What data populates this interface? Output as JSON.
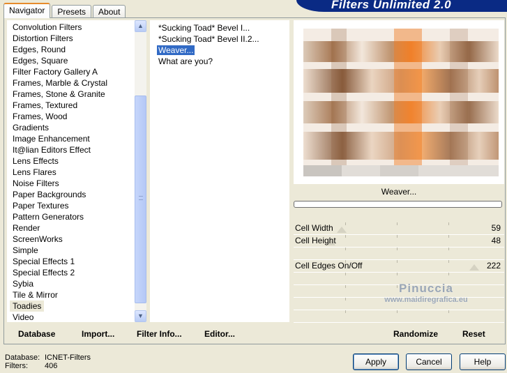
{
  "tabs": [
    "Navigator",
    "Presets",
    "About"
  ],
  "banner_title": "Filters Unlimited 2.0",
  "categories": [
    "Convolution Filters",
    "Distortion Filters",
    "Edges, Round",
    "Edges, Square",
    "Filter Factory Gallery A",
    "Frames, Marble & Crystal",
    "Frames, Stone & Granite",
    "Frames, Textured",
    "Frames, Wood",
    "Gradients",
    "Image Enhancement",
    "It@lian Editors Effect",
    "Lens Effects",
    "Lens Flares",
    "Noise Filters",
    "Paper Backgrounds",
    "Paper Textures",
    "Pattern Generators",
    "Render",
    "ScreenWorks",
    "Simple",
    "Special Effects 1",
    "Special Effects 2",
    "Sybia",
    "Tile & Mirror",
    "Toadies",
    "Video"
  ],
  "selected_category": "Toadies",
  "filters": [
    "*Sucking Toad*  Bevel I...",
    "*Sucking Toad*  Bevel II.2...",
    "Weaver...",
    "What are you?"
  ],
  "selected_filter": "Weaver...",
  "toolbar": {
    "database": "Database",
    "import": "Import...",
    "filter_info": "Filter Info...",
    "editor": "Editor..."
  },
  "filter_name": "Weaver...",
  "params": [
    {
      "label": "Cell Width",
      "value": "59"
    },
    {
      "label": "Cell Height",
      "value": "48"
    },
    {
      "label": "",
      "value": ""
    },
    {
      "label": "Cell Edges On/Off",
      "value": "222"
    },
    {
      "label": "",
      "value": ""
    },
    {
      "label": "",
      "value": ""
    },
    {
      "label": "",
      "value": ""
    },
    {
      "label": "",
      "value": ""
    }
  ],
  "right_toolbar": {
    "randomize": "Randomize",
    "reset": "Reset"
  },
  "watermark": {
    "name": "Pinuccia",
    "url": "www.maidiregrafica.eu"
  },
  "footer": {
    "database_label": "Database:",
    "database_value": "ICNET-Filters",
    "filters_label": "Filters:",
    "filters_value": "406"
  },
  "buttons": {
    "apply": "Apply",
    "cancel": "Cancel",
    "help": "Help"
  },
  "colors": {
    "selection": "#316ac5",
    "banner": "#0a2a84",
    "tab_accent": "#e68b2c",
    "preview_orange": "#f07a1e"
  },
  "icons": [
    "scroll-up-icon",
    "scroll-down-icon"
  ]
}
